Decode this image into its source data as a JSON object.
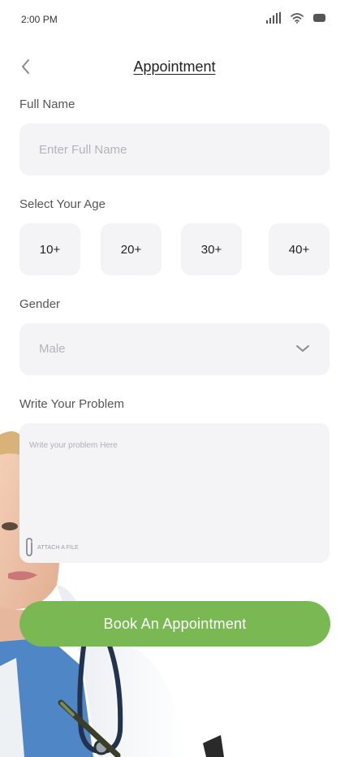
{
  "status_bar": {
    "time": "2:00 PM",
    "icons": [
      "signal-icon",
      "wifi-icon",
      "battery-icon"
    ]
  },
  "header": {
    "back_icon": "chevron-left-icon",
    "title": "Appointment"
  },
  "full_name": {
    "label": "Full Name",
    "placeholder": "Enter Full Name",
    "value": ""
  },
  "age": {
    "label": "Select Your Age",
    "options": [
      "10+",
      "20+",
      "30+",
      "40+"
    ]
  },
  "gender": {
    "label": "Gender",
    "selected": "Male",
    "icon": "chevron-down-icon"
  },
  "problem": {
    "label": "Write Your Problem",
    "placeholder": "Write your problem Here",
    "value": "",
    "attach_label": "ATTACH A FILE",
    "attach_icon": "paperclip-icon"
  },
  "actions": {
    "book_label": "Book An Appointment"
  },
  "colors": {
    "accent": "#7ab853",
    "field_background": "#f4f4f6"
  }
}
